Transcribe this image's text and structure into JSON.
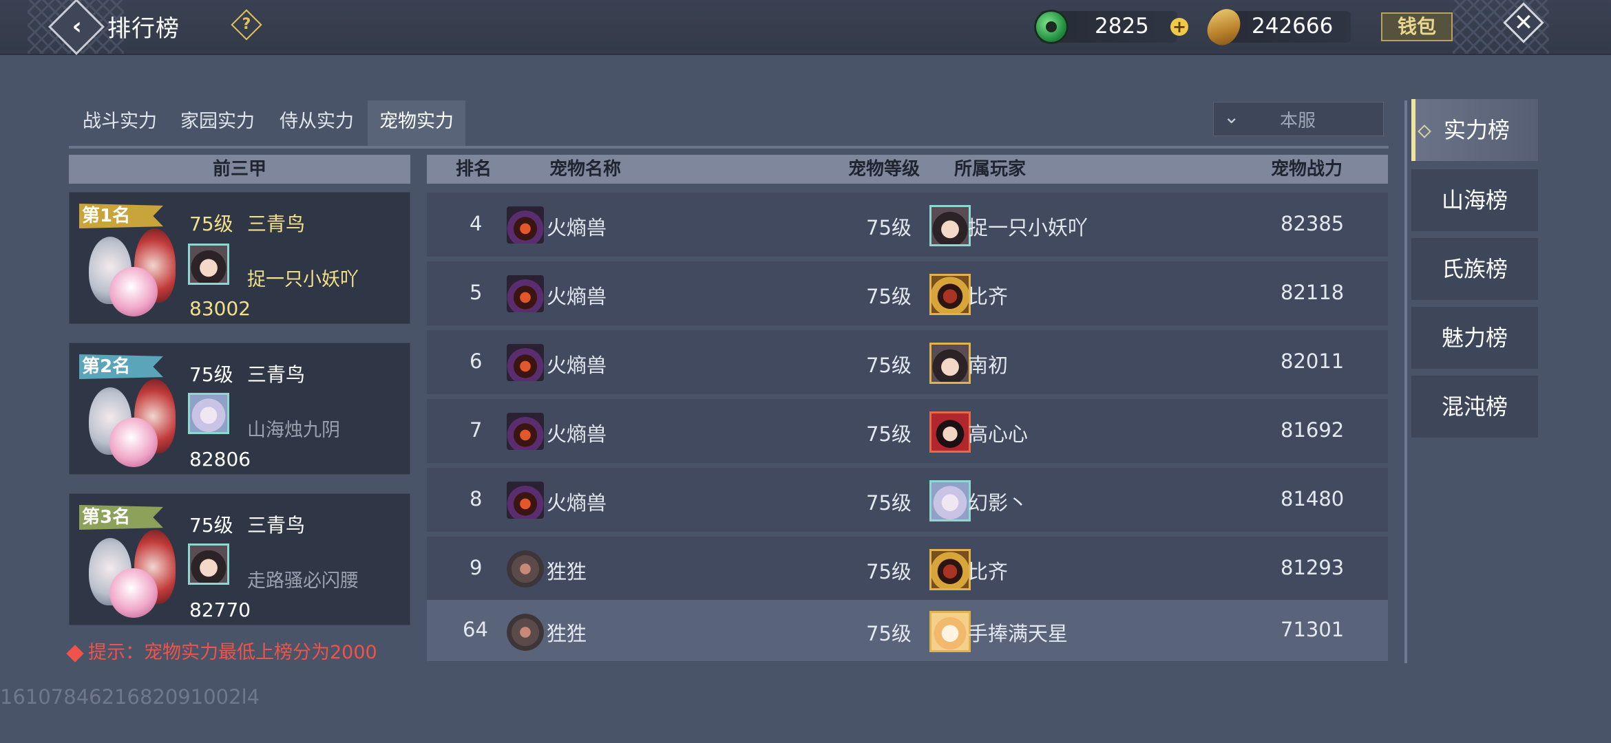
{
  "header": {
    "title": "排行榜",
    "help_icon": "question-icon",
    "jade_value": "2825",
    "gold_value": "242666",
    "wallet_label": "钱包"
  },
  "tabs": [
    "战斗实力",
    "家园实力",
    "侍从实力",
    "宠物实力"
  ],
  "active_tab": "宠物实力",
  "server_select": "本服",
  "top3": {
    "header": "前三甲",
    "entries": [
      {
        "rank_label": "第1名",
        "level": "75级",
        "pet_name": "三青鸟",
        "player": "捉一只小妖吖",
        "power": "83002"
      },
      {
        "rank_label": "第2名",
        "level": "75级",
        "pet_name": "三青鸟",
        "player": "山海烛九阴",
        "power": "82806"
      },
      {
        "rank_label": "第3名",
        "level": "75级",
        "pet_name": "三青鸟",
        "player": "走路骚必闪腰",
        "power": "82770"
      }
    ]
  },
  "tip": "提示：宠物实力最低上榜分为2000",
  "table": {
    "columns": [
      "排名",
      "宠物名称",
      "宠物等级",
      "所属玩家",
      "宠物战力"
    ],
    "rows": [
      {
        "rank": "4",
        "pet": "火熵兽",
        "level": "75级",
        "player": "捉一只小妖吖",
        "power": "82385"
      },
      {
        "rank": "5",
        "pet": "火熵兽",
        "level": "75级",
        "player": "比齐",
        "power": "82118"
      },
      {
        "rank": "6",
        "pet": "火熵兽",
        "level": "75级",
        "player": "南初",
        "power": "82011"
      },
      {
        "rank": "7",
        "pet": "火熵兽",
        "level": "75级",
        "player": "高心心",
        "power": "81692"
      },
      {
        "rank": "8",
        "pet": "火熵兽",
        "level": "75级",
        "player": "幻影丶",
        "power": "81480"
      },
      {
        "rank": "9",
        "pet": "狌狌",
        "level": "75级",
        "player": "比齐",
        "power": "81293"
      }
    ],
    "my_row": {
      "rank": "64",
      "pet": "狌狌",
      "level": "75级",
      "player": "手捧满天星",
      "power": "71301"
    }
  },
  "side_tabs": [
    "实力榜",
    "山海榜",
    "氏族榜",
    "魅力榜",
    "混沌榜"
  ],
  "active_side_tab": "实力榜",
  "uid": "1610784621682091002l4"
}
